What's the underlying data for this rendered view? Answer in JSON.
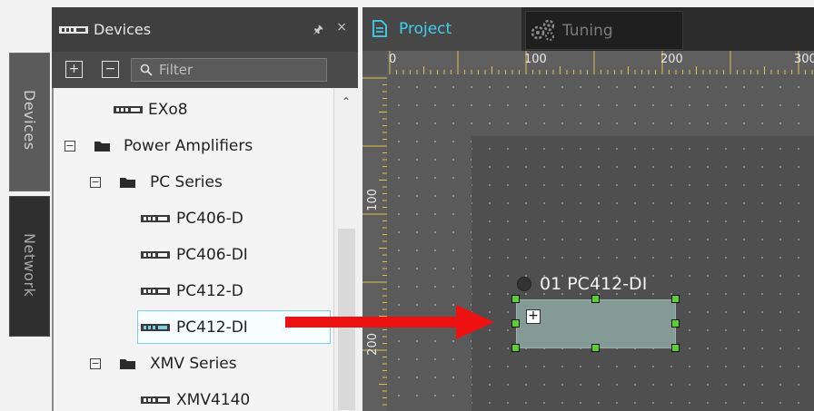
{
  "side_tabs": {
    "devices": "Devices",
    "network": "Network"
  },
  "devices_panel": {
    "title": "Devices",
    "filter_placeholder": "Filter",
    "tree": [
      {
        "label": "EXo8",
        "kind": "device"
      },
      {
        "label": "Power Amplifiers",
        "kind": "folder",
        "expanded": true
      },
      {
        "label": "PC Series",
        "kind": "folder",
        "expanded": true
      },
      {
        "label": "PC406-D",
        "kind": "device"
      },
      {
        "label": "PC406-DI",
        "kind": "device"
      },
      {
        "label": "PC412-D",
        "kind": "device"
      },
      {
        "label": "PC412-DI",
        "kind": "device",
        "selected": true
      },
      {
        "label": "XMV Series",
        "kind": "folder",
        "expanded": true
      },
      {
        "label": "XMV4140",
        "kind": "device"
      }
    ]
  },
  "editor_tabs": {
    "project": "Project",
    "tuning": "Tuning"
  },
  "ruler": {
    "top": [
      "0",
      "100",
      "200",
      "300"
    ],
    "left": [
      "100",
      "200"
    ]
  },
  "component": {
    "label": "01 PC412-DI"
  },
  "colors": {
    "accent": "#3fd0ef",
    "handle": "#57d22f",
    "arrow": "#ee1111",
    "selection_border": "#7ad2e8"
  }
}
